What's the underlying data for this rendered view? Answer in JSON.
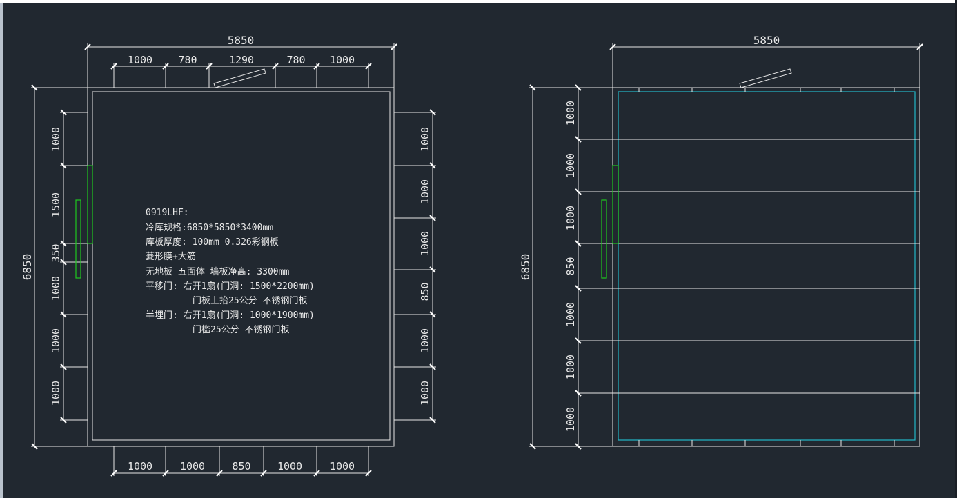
{
  "colors": {
    "background": "#212830",
    "lines": "#e6e6e6",
    "insulation_panel": "#22b8c8",
    "door": "#1ec81e"
  },
  "left_plan": {
    "width_total": "5850",
    "top_segments": [
      "1000",
      "780",
      "1290",
      "780",
      "1000"
    ],
    "bottom_segments": [
      "1000",
      "1000",
      "850",
      "1000",
      "1000"
    ],
    "height_total": "6850",
    "left_segments": [
      "1000",
      "1500",
      "350",
      "1000",
      "1000",
      "1000"
    ],
    "right_segments": [
      "1000",
      "1000",
      "1000",
      "850",
      "1000",
      "1000"
    ]
  },
  "right_plan": {
    "width_total": "5850",
    "height_total": "6850",
    "left_segments": [
      "1000",
      "1000",
      "1000",
      "850",
      "1000",
      "1000",
      "1000"
    ]
  },
  "spec_notes": {
    "line1": "0919LHF:",
    "line2": "冷库规格:6850*5850*3400mm",
    "line3": "库板厚度: 100mm  0.326彩钢板",
    "line4": "菱形膜+大筋",
    "line5": "无地板  五面体  墙板净高: 3300mm",
    "line6": "平移门: 右开1扇(门洞: 1500*2200mm)",
    "line7": "门板上抬25公分   不锈钢门板",
    "line8": "半埋门: 右开1扇(门洞: 1000*1900mm)",
    "line9": "门槛25公分   不锈钢门板"
  }
}
